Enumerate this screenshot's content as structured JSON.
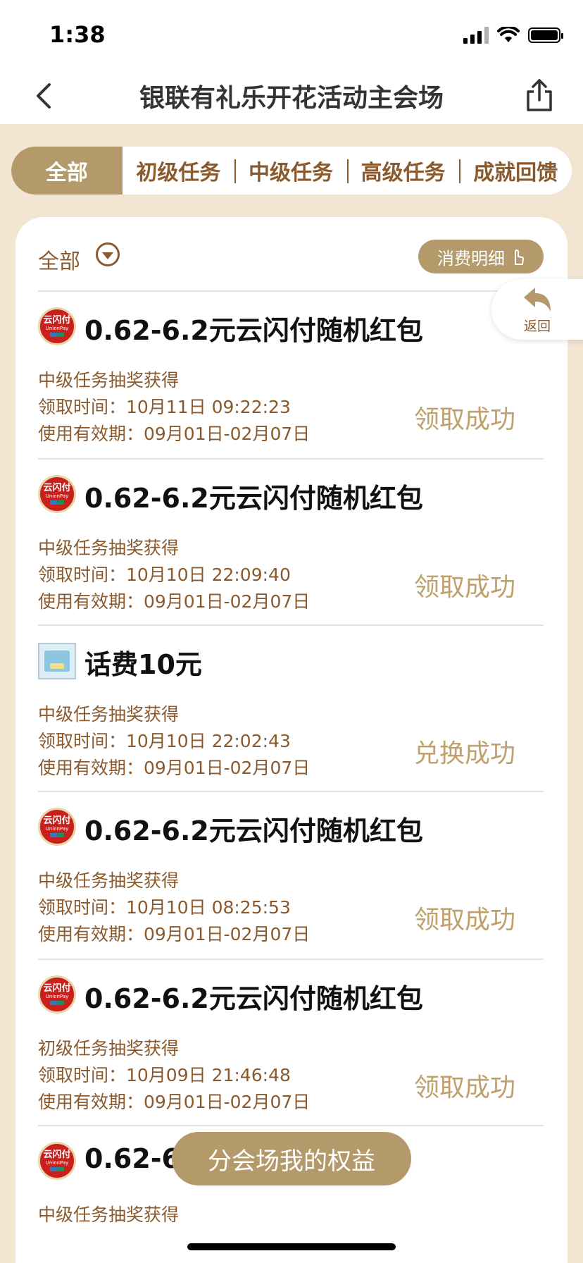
{
  "status_bar": {
    "time": "1:38"
  },
  "nav": {
    "title": "银联有礼乐开花活动主会场"
  },
  "tabs": [
    {
      "label": "全部",
      "active": true
    },
    {
      "label": "初级任务",
      "active": false
    },
    {
      "label": "中级任务",
      "active": false
    },
    {
      "label": "高级任务",
      "active": false
    },
    {
      "label": "成就回馈",
      "active": false
    }
  ],
  "filter": {
    "label": "全部"
  },
  "detail_button": {
    "label": "消费明细"
  },
  "return_float": {
    "label": "返回"
  },
  "logo": {
    "text": "云闪付",
    "subtext": "UnionPay"
  },
  "items": [
    {
      "icon": "unionpay-logo",
      "title": "0.62-6.2元云闪付随机红包",
      "source": "中级任务抽奖获得",
      "time": "领取时间：10月11日 09:22:23",
      "valid": "使用有效期：09月01日-02月07日",
      "status": "领取成功"
    },
    {
      "icon": "unionpay-logo",
      "title": "0.62-6.2元云闪付随机红包",
      "source": "中级任务抽奖获得",
      "time": "领取时间：10月10日 22:09:40",
      "valid": "使用有效期：09月01日-02月07日",
      "status": "领取成功"
    },
    {
      "icon": "phone-card",
      "title": "话费10元",
      "source": "中级任务抽奖获得",
      "time": "领取时间：10月10日 22:02:43",
      "valid": "使用有效期：09月01日-02月07日",
      "status": "兑换成功"
    },
    {
      "icon": "unionpay-logo",
      "title": "0.62-6.2元云闪付随机红包",
      "source": "中级任务抽奖获得",
      "time": "领取时间：10月10日 08:25:53",
      "valid": "使用有效期：09月01日-02月07日",
      "status": "领取成功"
    },
    {
      "icon": "unionpay-logo",
      "title": "0.62-6.2元云闪付随机红包",
      "source": "初级任务抽奖获得",
      "time": "领取时间：10月09日 21:46:48",
      "valid": "使用有效期：09月01日-02月07日",
      "status": "领取成功"
    },
    {
      "icon": "unionpay-logo",
      "title": "0.62-6",
      "source": "中级任务抽奖获得"
    }
  ],
  "bottom_button": {
    "label": "分会场我的权益"
  },
  "colors": {
    "gold": "#B49A6A",
    "brown_text": "#8A5A2E",
    "status_gold": "#C0A06C",
    "page_bg": "#F2E6D2"
  }
}
